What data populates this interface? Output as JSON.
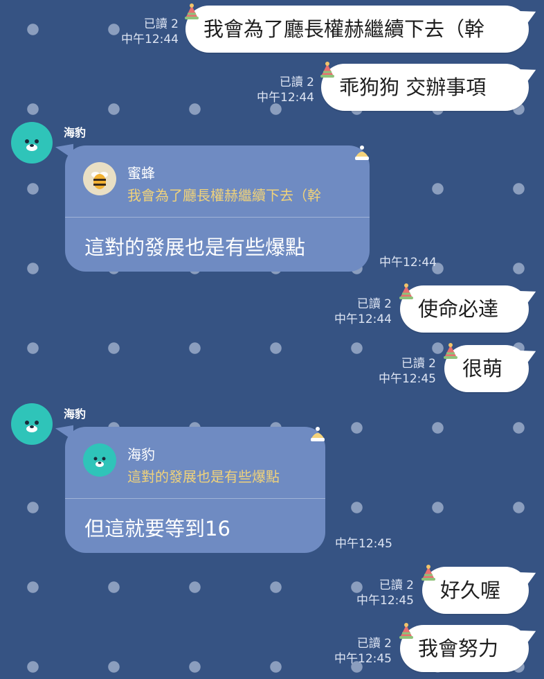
{
  "chat": {
    "outgoing": [
      {
        "text": "我會為了廳長權赫繼續下去（幹",
        "read": "已讀 2",
        "time": "中午12:44"
      },
      {
        "text": "乖狗狗 交辦事項",
        "read": "已讀 2",
        "time": "中午12:44"
      },
      {
        "text": "使命必達",
        "read": "已讀 2",
        "time": "中午12:44"
      },
      {
        "text": "很萌",
        "read": "已讀 2",
        "time": "中午12:45"
      },
      {
        "text": "好久喔",
        "read": "已讀 2",
        "time": "中午12:45"
      },
      {
        "text": "我會努力",
        "read": "已讀 2",
        "time": "中午12:45"
      }
    ],
    "incoming": [
      {
        "sender": "海豹",
        "reply_to_name": "蜜蜂",
        "reply_to_text": "我會為了廳長權赫繼續下去（幹",
        "text": "這對的發展也是有些爆點",
        "time": "中午12:44"
      },
      {
        "sender": "海豹",
        "reply_to_name": "海豹",
        "reply_to_text": "這對的發展也是有些爆點",
        "text": "但這就要等到16",
        "time": "中午12:45"
      }
    ]
  },
  "colors": {
    "background": "#365383",
    "incoming_bubble": "#6f8bc2",
    "outgoing_bubble": "#ffffff",
    "quote_text": "#f1d37a",
    "avatar_teal": "#2fc4b9"
  }
}
